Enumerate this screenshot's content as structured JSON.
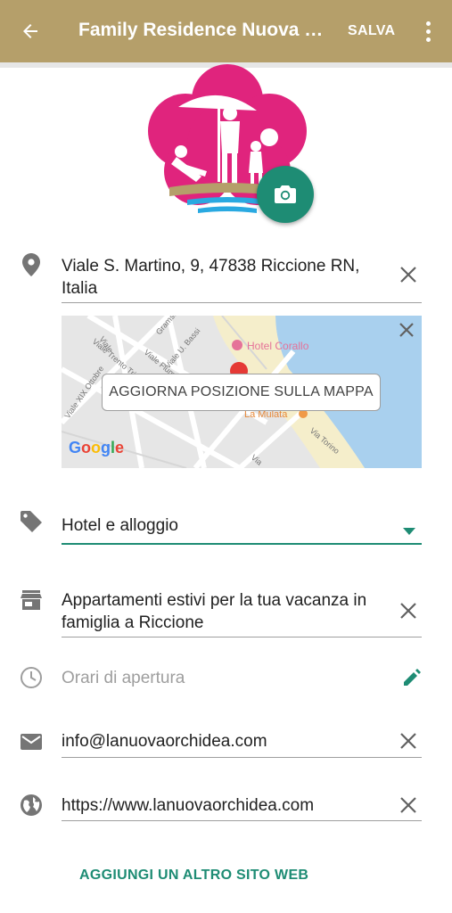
{
  "appbar": {
    "title": "Family Residence Nuova Or...",
    "save_label": "SALVA",
    "background_color": "#b59f6a"
  },
  "logo": {
    "description_icon": "beach-family-flower-logo",
    "camera_icon": "camera-icon"
  },
  "address": {
    "value": "Viale S. Martino, 9, 47838 Riccione RN, Italia",
    "icon": "location-pin-icon"
  },
  "map": {
    "update_button_label": "AGGIORNA POSIZIONE SULLA MAPPA",
    "labels": {
      "hotel": "Hotel Corallo",
      "restaurant": "La Mulata",
      "street_torino": "Via Torino",
      "street_fiume": "Viale Fiume",
      "street_trento": "Viale Trento Trieste",
      "street_ottobre": "Viale XIX Ottobre",
      "street_gramsci": "Gramsci",
      "street_basso": "Viale U. Bassi",
      "street_corso": "Viale Corso Fratelli",
      "street_v": "Via"
    },
    "google_logo": "Google"
  },
  "category": {
    "value": "Hotel e alloggio",
    "icon": "tag-icon"
  },
  "description": {
    "value": "Appartamenti estivi per la tua vacanza in famiglia a Riccione",
    "icon": "store-icon"
  },
  "hours": {
    "placeholder": "Orari di apertura",
    "icon": "clock-icon"
  },
  "email": {
    "value": "info@lanuovaorchidea.com",
    "icon": "mail-icon"
  },
  "website": {
    "value": "https://www.lanuovaorchidea.com",
    "icon": "globe-icon"
  },
  "add_website_label": "AGGIUNGI UN ALTRO SITO WEB",
  "colors": {
    "accent": "#1e8c74",
    "logo_magenta": "#e0247d"
  }
}
